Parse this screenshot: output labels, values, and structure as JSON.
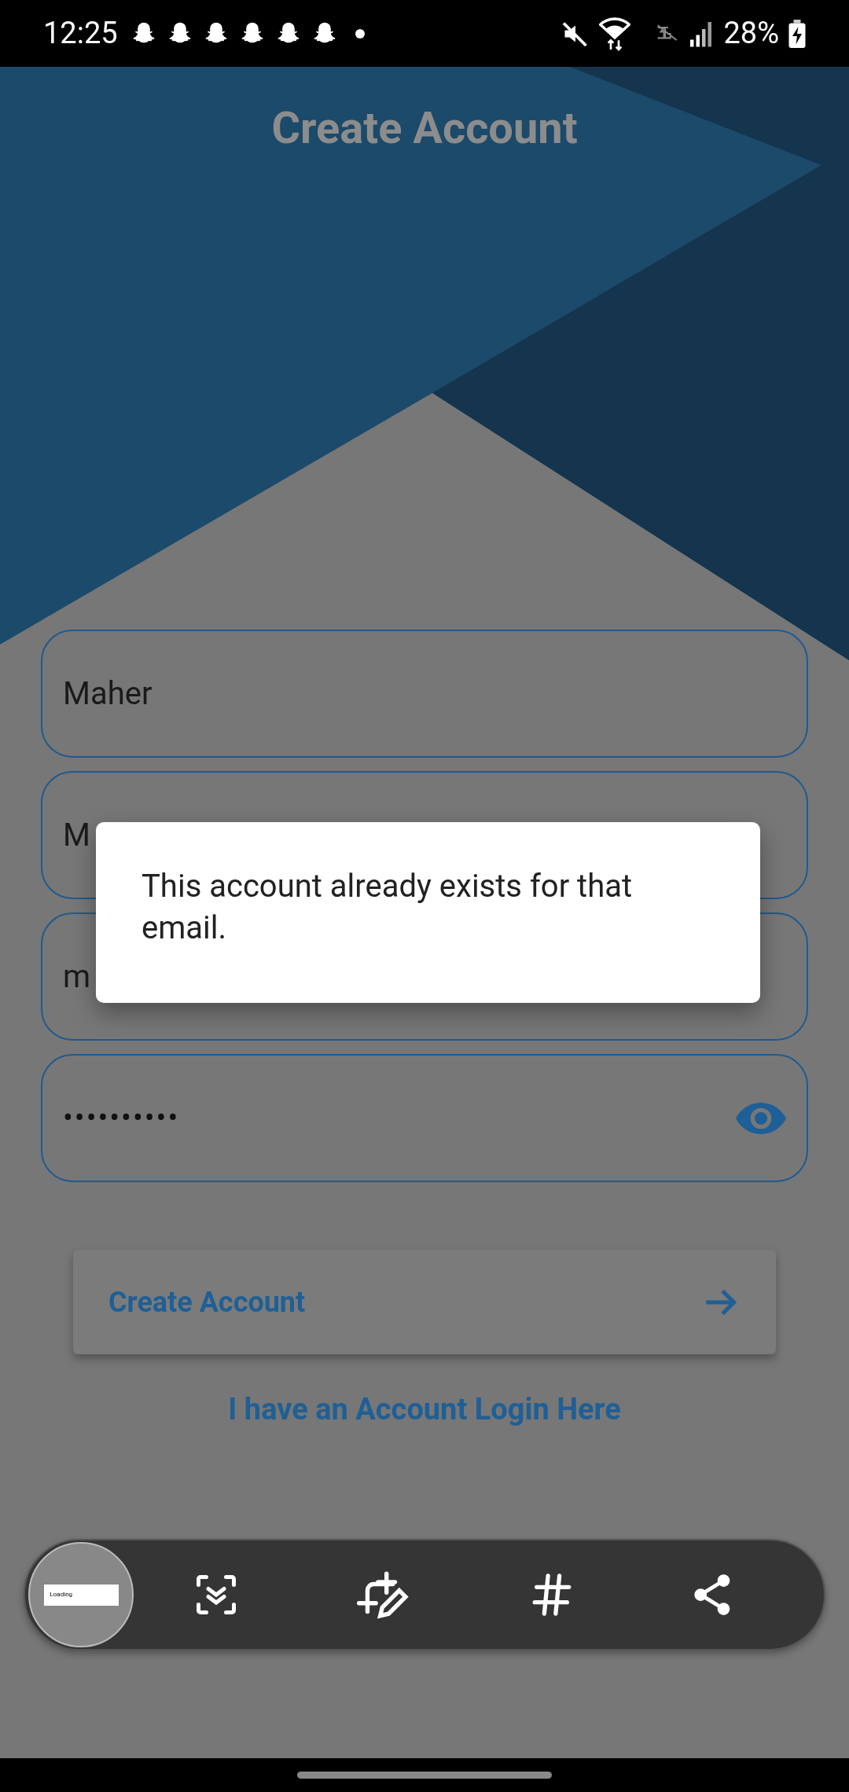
{
  "status_bar": {
    "time": "12:25",
    "battery": "28%"
  },
  "title": "Create Account",
  "fields": [
    {
      "kind": "text",
      "value": "Maher"
    },
    {
      "kind": "text",
      "value": "M"
    },
    {
      "kind": "text",
      "value": "m"
    },
    {
      "kind": "password",
      "value": "••••••••••"
    }
  ],
  "submit_button": {
    "label": "Create Account"
  },
  "login_link": "I have an Account Login Here",
  "dialog": {
    "message": "This account already exists for that email."
  },
  "screenshot_toolbar": {
    "thumbnail_text": "Loading"
  }
}
